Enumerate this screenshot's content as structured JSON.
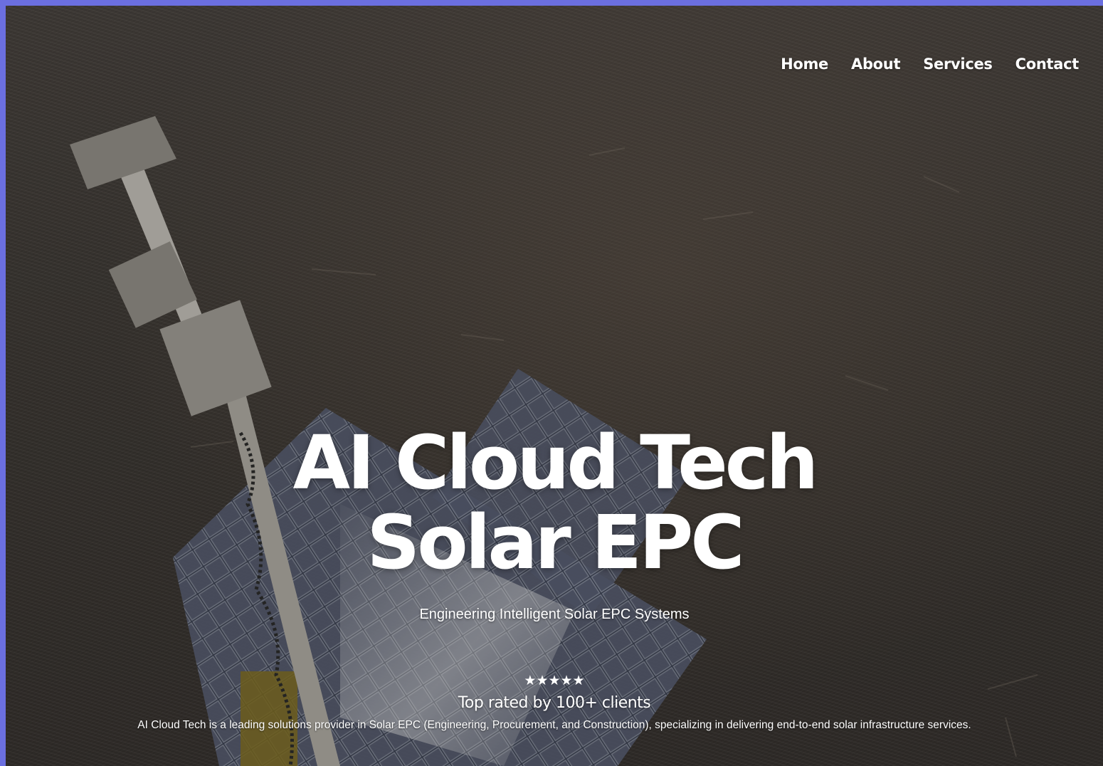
{
  "nav": {
    "items": [
      {
        "label": "Home"
      },
      {
        "label": "About"
      },
      {
        "label": "Services"
      },
      {
        "label": "Contact"
      }
    ]
  },
  "hero": {
    "title_line1": "AI Cloud Tech",
    "title_line2": "Solar EPC",
    "subtitle": "Engineering Intelligent Solar EPC Systems",
    "stars": "★★★★★",
    "rating_text": "Top rated by 100+ clients",
    "description": "AI Cloud Tech is a leading solutions provider in Solar EPC (Engineering, Procurement, and Construction), specializing in delivering end-to-end solar infrastructure services."
  },
  "colors": {
    "frame_border": "#6b6fe0",
    "text": "#ffffff",
    "ground": "#413b37"
  }
}
